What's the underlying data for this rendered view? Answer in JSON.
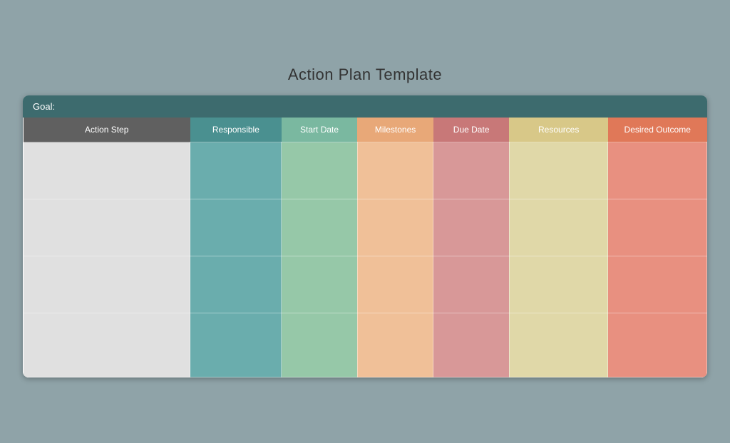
{
  "page": {
    "title": "Action Plan Template"
  },
  "goal_bar": {
    "label": "Goal:"
  },
  "table": {
    "headers": [
      {
        "key": "action",
        "label": "Action Step",
        "class": "col-action"
      },
      {
        "key": "responsible",
        "label": "Responsible",
        "class": "col-responsible"
      },
      {
        "key": "startdate",
        "label": "Start Date",
        "class": "col-startdate"
      },
      {
        "key": "milestones",
        "label": "Milestones",
        "class": "col-milestones"
      },
      {
        "key": "duedate",
        "label": "Due Date",
        "class": "col-duedate"
      },
      {
        "key": "resources",
        "label": "Resources",
        "class": "col-resources"
      },
      {
        "key": "outcome",
        "label": "Desired Outcome",
        "class": "col-outcome"
      }
    ],
    "rows": [
      {
        "id": 1
      },
      {
        "id": 2
      },
      {
        "id": 3
      },
      {
        "id": 4
      }
    ]
  }
}
